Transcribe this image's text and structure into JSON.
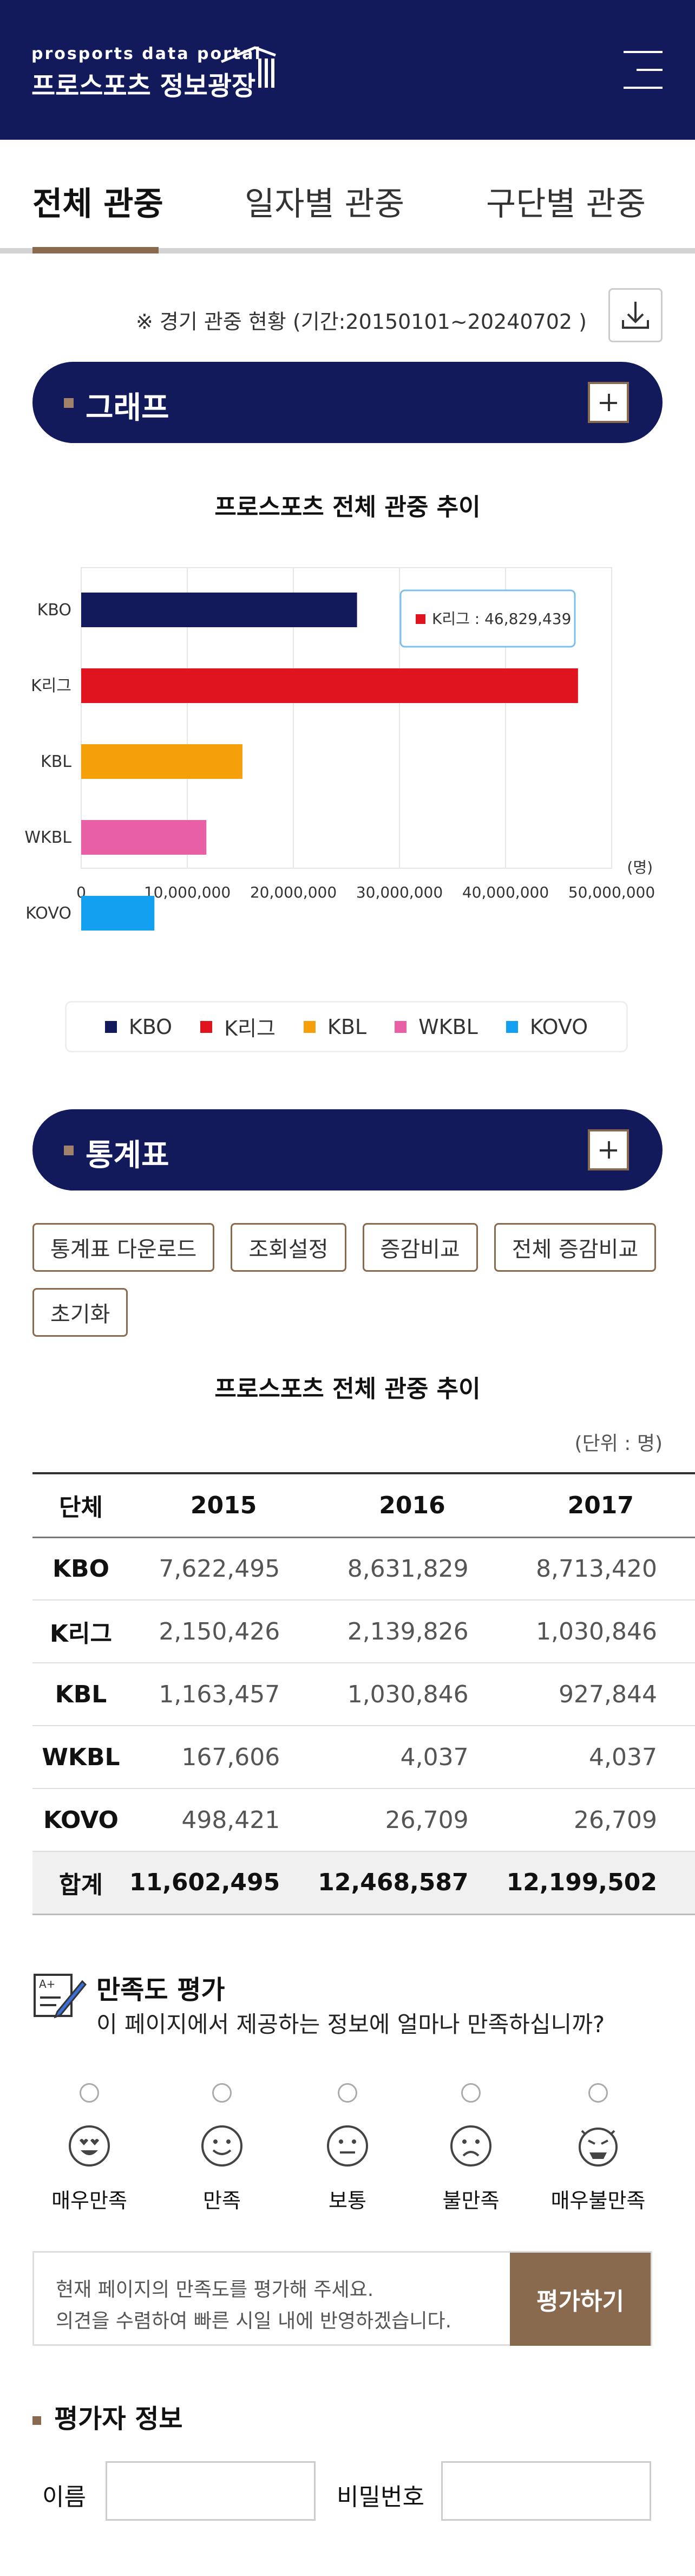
{
  "header": {
    "logo_small": "prosports data portal",
    "logo_main": "프로스포츠 정보광장"
  },
  "tabs": [
    {
      "label": "전체 관중"
    },
    {
      "label": "일자별 관중"
    },
    {
      "label": "구단별 관중"
    }
  ],
  "notice": "※ 경기 관중 현황 (기간:20150101~20240702 )",
  "graph_section": {
    "title": "그래프"
  },
  "chart_data": {
    "type": "bar",
    "orientation": "horizontal",
    "title": "프로스포츠 전체 관중 추이",
    "categories": [
      "KBO",
      "K리그",
      "KBL",
      "WKBL",
      "KOVO"
    ],
    "values": [
      26000000,
      46829439,
      15200000,
      11800000,
      6900000
    ],
    "colors": [
      "#121a5c",
      "#e0141e",
      "#f5a00b",
      "#e85fa6",
      "#14a0f0"
    ],
    "x_ticks": [
      "0",
      "10,000,000",
      "20,000,000",
      "30,000,000",
      "40,000,000",
      "50,000,000"
    ],
    "xlim": [
      0,
      50000000
    ],
    "unit": "(명)",
    "tooltip": "K리그 : 46,829,439",
    "legend": [
      "KBO",
      "K리그",
      "KBL",
      "WKBL",
      "KOVO"
    ],
    "grid": true
  },
  "stats_section": {
    "title": "통계표",
    "buttons": [
      "통계표 다운로드",
      "조회설정",
      "증감비교",
      "전체 증감비교",
      "초기화"
    ],
    "table_title": "프로스포츠 전체 관중 추이",
    "unit": "(단위 : 명)",
    "headers": [
      "단체",
      "2015",
      "2016",
      "2017"
    ],
    "rows": [
      [
        "KBO",
        "7,622,495",
        "8,631,829",
        "8,713,420"
      ],
      [
        "K리그",
        "2,150,426",
        "2,139,826",
        "1,030,846"
      ],
      [
        "KBL",
        "1,163,457",
        "1,030,846",
        "927,844"
      ],
      [
        "WKBL",
        "167,606",
        "4,037",
        "4,037"
      ],
      [
        "KOVO",
        "498,421",
        "26,709",
        "26,709"
      ]
    ],
    "total": [
      "합계",
      "11,602,495",
      "12,468,587",
      "12,199,502"
    ]
  },
  "survey": {
    "title": "만족도 평가",
    "question": "이 페이지에서 제공하는 정보에 얼마나 만족하십니까?",
    "options": [
      "매우만족",
      "만족",
      "보통",
      "불만족",
      "매우불만족"
    ],
    "feedback_line1": "현재 페이지의 만족도를 평가해 주세요.",
    "feedback_line2": "의견을 수렴하여 빠른 시일 내에 반영하겠습니다.",
    "submit": "평가하기"
  },
  "rater": {
    "title": "평가자 정보",
    "name_label": "이름",
    "password_label": "비밀번호"
  }
}
